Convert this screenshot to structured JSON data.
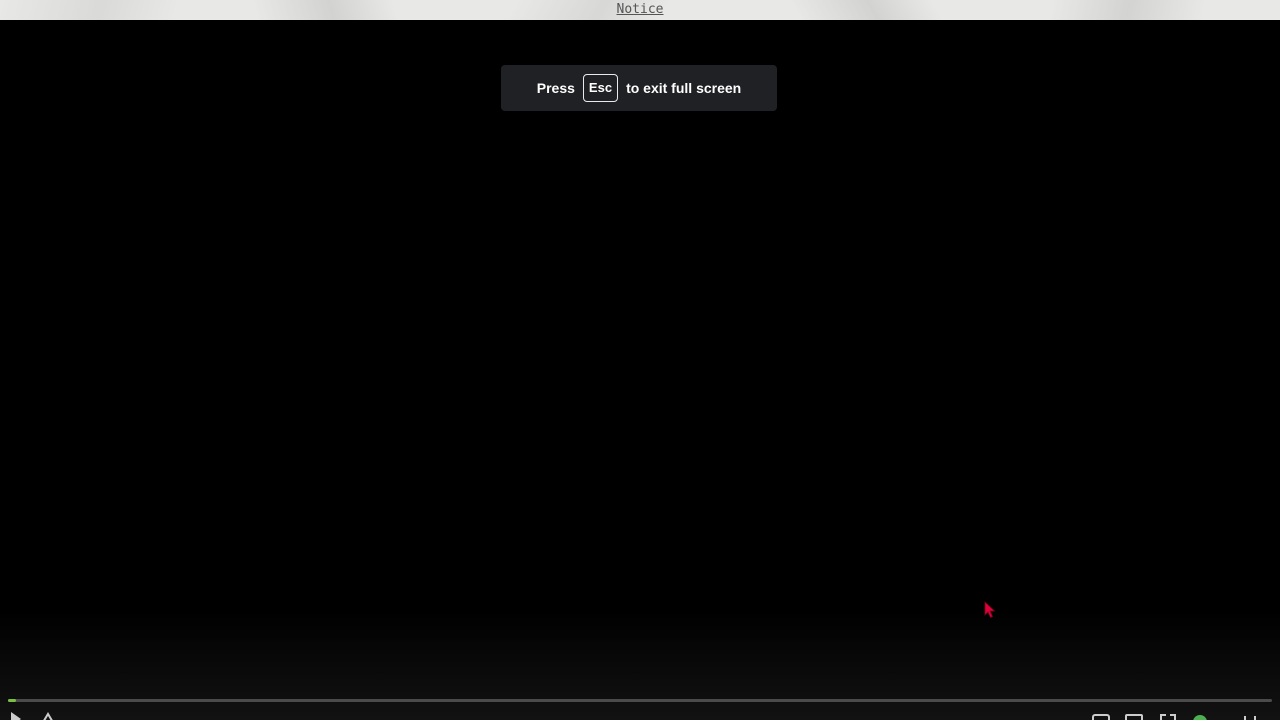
{
  "banner": {
    "notice_label": "Notice"
  },
  "fullscreen_toast": {
    "press_text": "Press",
    "key_label": "Esc",
    "suffix_text": "to exit full screen"
  },
  "player": {
    "progress_fraction": 0.006,
    "accent_color": "#7ac142",
    "controls": [
      "play-icon",
      "skip-icon",
      "subtitles-icon",
      "settings-icon",
      "fullscreen-icon",
      "chromecast-icon",
      "more-icon"
    ]
  },
  "colors": {
    "background": "#000000",
    "toast_background": "#202124",
    "cursor": "#e0003a"
  }
}
